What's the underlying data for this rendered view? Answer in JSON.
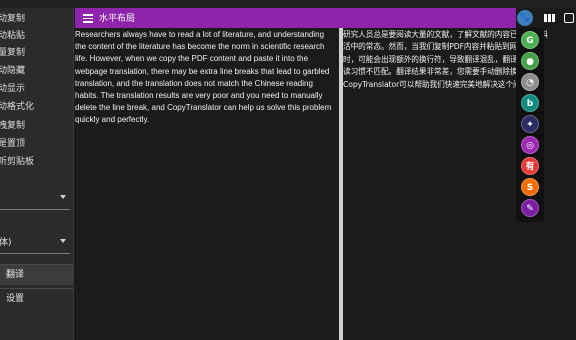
{
  "window": {
    "title": "水平布局"
  },
  "sidebar": {
    "menu_items": [
      {
        "label": "动复制"
      },
      {
        "label": "动粘贴"
      },
      {
        "label": "量复制"
      },
      {
        "label": "动隐藏"
      },
      {
        "label": "动显示"
      },
      {
        "label": "动格式化"
      },
      {
        "label": "拽复制"
      },
      {
        "label": "是置顶"
      },
      {
        "label": "听剪贴板"
      }
    ],
    "select_1": {
      "value": ""
    },
    "select_2": {
      "value": "体)"
    },
    "nav": [
      {
        "label": "翻译"
      },
      {
        "label": "设置"
      }
    ]
  },
  "source": {
    "text": "Researchers always have to read a lot of literature, and understanding the content of the literature has become the norm in scientific research life. However, when we copy the PDF content and paste it into the webpage translation, there may be extra line breaks that lead to garbled translation, and the translation does not match the Chinese reading habits. The translation results are very poor and you need to manually delete the line break, and CopyTranslator can help us solve this problem quickly and perfectly."
  },
  "result": {
    "lines": [
      "研究人员总是要阅读大量的文献，了解文献的内容已经成为科",
      "活中的常态。然而，当我们复制PDF内容并粘贴到网页翻",
      "时，可能会出现额外的换行符，导致翻译混乱，翻译与中",
      "读习惯不匹配。翻译结果非常差，您需要手动删除换行符，",
      "CopyTranslator可以帮助我们快速完美地解决这个问题。"
    ]
  },
  "dock": {
    "engines": [
      {
        "name": "google-engine-icon",
        "glyph": "G",
        "color": "#4caf50"
      },
      {
        "name": "chrome-engine-icon",
        "glyph": "●",
        "color": "#43a047"
      },
      {
        "name": "baidu-engine-icon",
        "glyph": "◔",
        "color": "#8e8e8e"
      },
      {
        "name": "bing-engine-icon",
        "glyph": "b",
        "color": "#0f8a7e"
      },
      {
        "name": "caiyun-engine-icon",
        "glyph": "✦",
        "color": "#2c2c64"
      },
      {
        "name": "tencent-engine-icon",
        "glyph": "◎",
        "color": "#9c27b0"
      },
      {
        "name": "youdao-engine-icon",
        "glyph": "有",
        "color": "#e53935"
      },
      {
        "name": "sogou-engine-icon",
        "glyph": "S",
        "color": "#ef6c00"
      },
      {
        "name": "deepl-engine-icon",
        "glyph": "✎",
        "color": "#7b1fa2"
      }
    ]
  },
  "colors": {
    "accent": "#8e24aa",
    "background": "#1b1b1b",
    "sidebar": "#2b2b2b"
  }
}
